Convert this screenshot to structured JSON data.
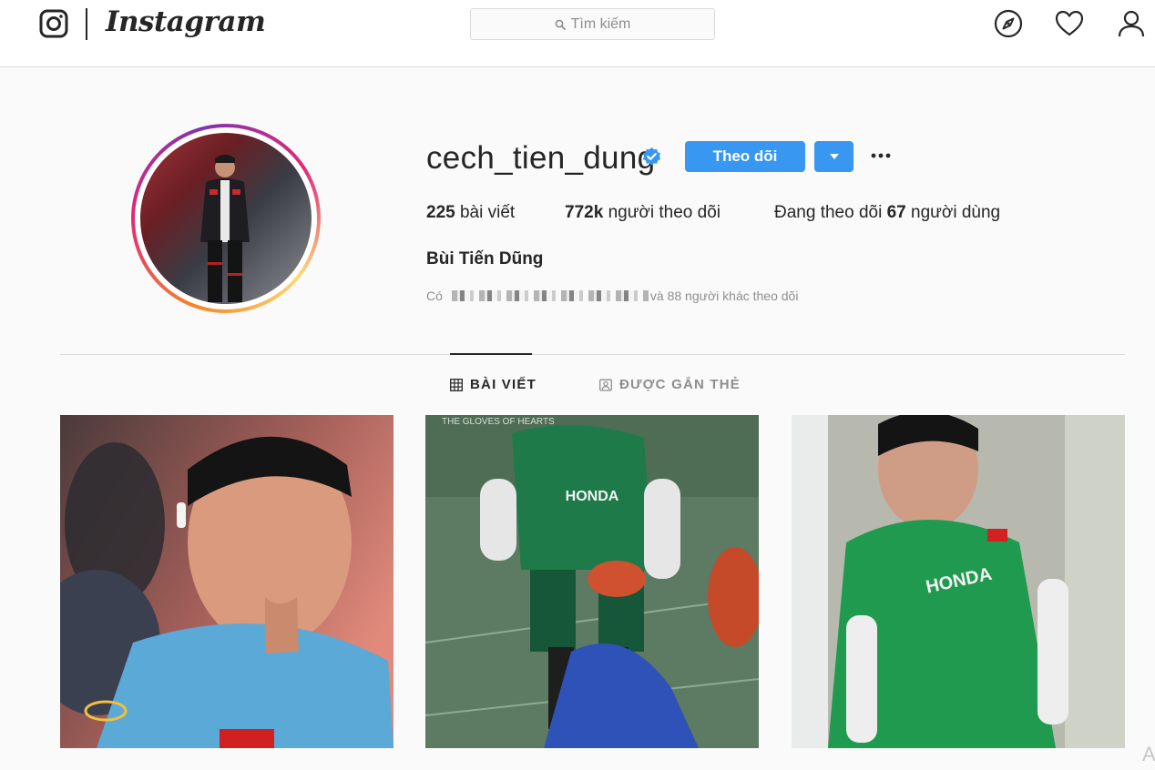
{
  "nav": {
    "brand": "Instagram",
    "search_placeholder": "Tìm kiếm",
    "icons": [
      "instagram-glyph-icon",
      "search-icon",
      "compass-icon",
      "heart-icon",
      "profile-icon"
    ]
  },
  "profile": {
    "username": "cech_tien_dung",
    "verified": true,
    "follow_label": "Theo dõi",
    "stats": {
      "posts_count": "225",
      "posts_label": "bài viết",
      "followers_count": "772k",
      "followers_label": "người theo dõi",
      "following_prefix": "Đang theo dõi",
      "following_count": "67",
      "following_label": "người dùng"
    },
    "full_name": "Bùi Tiến Dũng",
    "followed_by_prefix": "Có",
    "followed_by_suffix": "và 88 người khác theo dõi"
  },
  "tabs": {
    "posts": "BÀI VIẾT",
    "tagged": "ĐƯỢC GẮN THẺ"
  },
  "posts": [
    {
      "caption_overlay": ""
    },
    {
      "caption_overlay": "THE GLOVES OF HEARTS"
    },
    {
      "caption_overlay": ""
    }
  ],
  "colors": {
    "accent": "#3897f0",
    "border": "#dbdbdb",
    "muted_text": "#8e8e8e",
    "text": "#262626",
    "background": "#fafafa"
  }
}
